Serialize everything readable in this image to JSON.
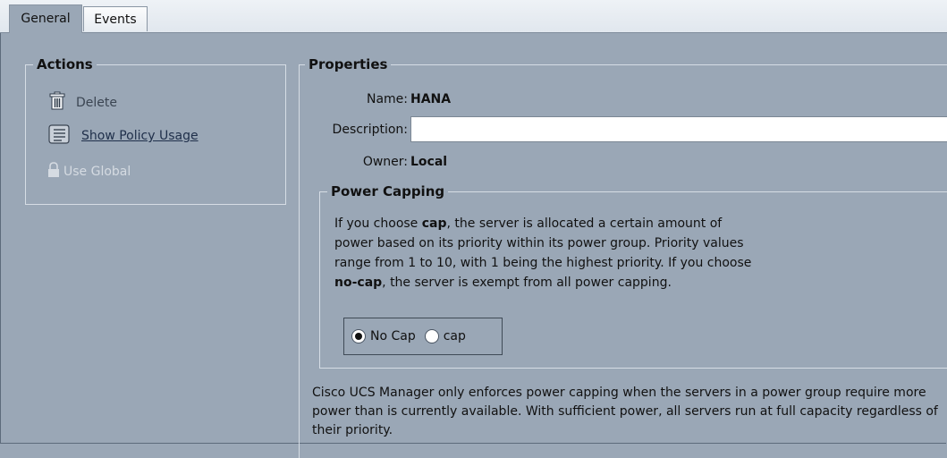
{
  "tabs": [
    {
      "label": "General"
    },
    {
      "label": "Events"
    }
  ],
  "actions": {
    "title": "Actions",
    "delete_label": "Delete",
    "usage_label": "Show Policy Usage",
    "global_label": "Use Global"
  },
  "properties": {
    "title": "Properties",
    "name_label": "Name:",
    "name_value": "HANA",
    "description_label": "Description:",
    "description_value": "",
    "owner_label": "Owner:",
    "owner_value": "Local"
  },
  "power_capping": {
    "title": "Power Capping",
    "text_pre": "If you choose ",
    "text_cap": "cap",
    "text_mid": ", the server is allocated a certain amount of power based on its priority within its power group. Priority values range from 1 to 10, with 1 being the highest priority. If you choose ",
    "text_nocap": "no-cap",
    "text_post": ", the server is exempt from all power capping.",
    "options": [
      {
        "label": "No Cap",
        "selected": true
      },
      {
        "label": "cap",
        "selected": false
      }
    ]
  },
  "footer": {
    "text": "Cisco UCS Manager only enforces power capping when the servers in a power group require more power than is currently available. With sufficient power, all servers run at full capacity regardless of their priority."
  },
  "colors": {
    "panel_bg": "#9aa7b6",
    "link": "#1f2f4a",
    "disabled": "#d5dbe2"
  }
}
